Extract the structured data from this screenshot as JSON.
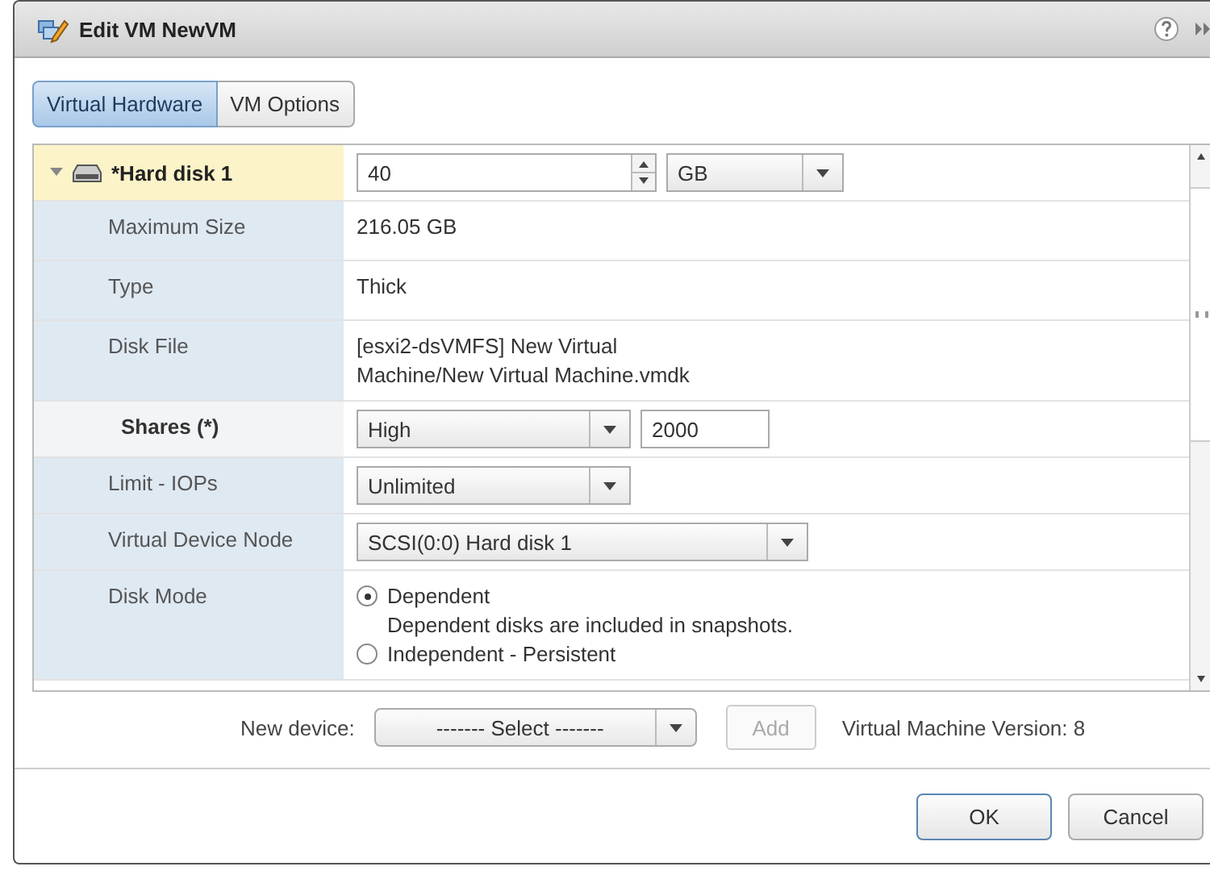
{
  "window": {
    "title": "Edit VM NewVM"
  },
  "tabs": [
    {
      "label": "Virtual Hardware",
      "selected": true
    },
    {
      "label": "VM Options",
      "selected": false
    }
  ],
  "rows": [
    {
      "kind": "header",
      "label": "*Hard disk 1",
      "expanded": true,
      "value": "40",
      "unit": "GB"
    },
    {
      "kind": "text",
      "label": "Maximum Size",
      "lines": [
        "216.05 GB"
      ]
    },
    {
      "kind": "text",
      "label": "Type",
      "lines": [
        "Thick"
      ]
    },
    {
      "kind": "text",
      "label": "Disk File",
      "lines": [
        "[esxi2-dsVMFS] New Virtual",
        "Machine/New Virtual Machine.vmdk"
      ]
    },
    {
      "kind": "select_input",
      "label": "Shares (*)",
      "value": "High",
      "input": "2000"
    },
    {
      "kind": "select",
      "label": "Limit - IOPs",
      "value": "Unlimited"
    },
    {
      "kind": "select",
      "label": "Virtual Device Node",
      "value": "SCSI(0:0) Hard disk 1"
    },
    {
      "kind": "radio",
      "label": "Disk Mode",
      "options": [
        {
          "label": "Dependent",
          "description": "Dependent disks are included in snapshots.",
          "selected": true
        },
        {
          "label": "Independent - Persistent",
          "selected": false
        }
      ]
    }
  ],
  "new_device": {
    "label": "New device:",
    "value": "------- Select -------",
    "add": {
      "label": "Add",
      "disabled": true
    }
  },
  "version": "Virtual Machine Version: 8",
  "buttons": [
    {
      "label": "OK",
      "kind": "primary"
    },
    {
      "label": "Cancel",
      "kind": "normal"
    }
  ]
}
